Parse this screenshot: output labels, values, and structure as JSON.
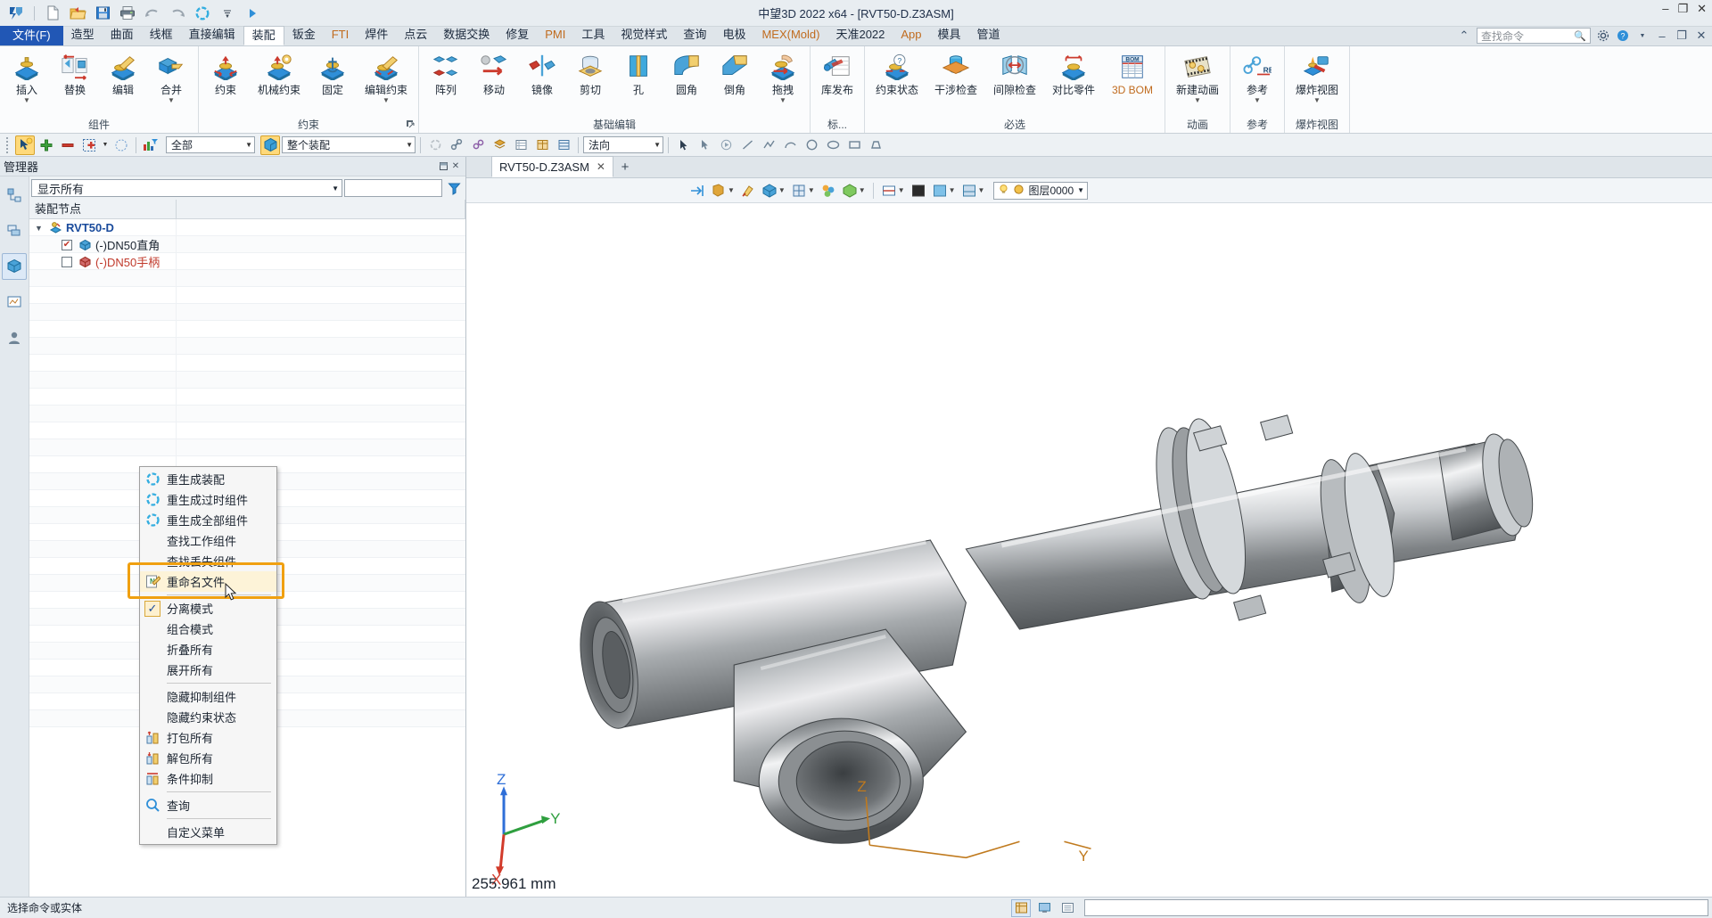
{
  "window": {
    "title": "中望3D 2022 x64 - [RVT50-D.Z3ASM]",
    "minimize": "–",
    "maximize": "❐",
    "close": "✕"
  },
  "quick_access": {
    "logo": "app-logo",
    "items": [
      {
        "name": "new-file-icon",
        "glyph": "new"
      },
      {
        "name": "open-file-icon",
        "glyph": "open"
      },
      {
        "name": "save-icon",
        "glyph": "save"
      },
      {
        "name": "print-icon",
        "glyph": "print"
      },
      {
        "name": "undo-icon",
        "glyph": "undo"
      },
      {
        "name": "redo-icon",
        "glyph": "redo"
      },
      {
        "name": "regen-icon",
        "glyph": "regen"
      },
      {
        "name": "qat-dropdown-icon",
        "glyph": "caret"
      },
      {
        "name": "play-icon",
        "glyph": "play"
      }
    ]
  },
  "tabs": [
    {
      "label": "文件(F)",
      "style": "file"
    },
    {
      "label": "造型",
      "style": "normal"
    },
    {
      "label": "曲面",
      "style": "normal"
    },
    {
      "label": "线框",
      "style": "normal"
    },
    {
      "label": "直接编辑",
      "style": "normal"
    },
    {
      "label": "装配",
      "style": "active"
    },
    {
      "label": "钣金",
      "style": "normal"
    },
    {
      "label": "FTI",
      "style": "orange"
    },
    {
      "label": "焊件",
      "style": "normal"
    },
    {
      "label": "点云",
      "style": "normal"
    },
    {
      "label": "数据交换",
      "style": "normal"
    },
    {
      "label": "修复",
      "style": "normal"
    },
    {
      "label": "PMI",
      "style": "orange"
    },
    {
      "label": "工具",
      "style": "normal"
    },
    {
      "label": "视觉样式",
      "style": "normal"
    },
    {
      "label": "查询",
      "style": "normal"
    },
    {
      "label": "电极",
      "style": "normal"
    },
    {
      "label": "MEX(Mold)",
      "style": "orange"
    },
    {
      "label": "天准2022",
      "style": "normal"
    },
    {
      "label": "App",
      "style": "orange"
    },
    {
      "label": "模具",
      "style": "normal"
    },
    {
      "label": "管道",
      "style": "normal"
    }
  ],
  "tabstrip_right": {
    "collapse_ribbon": "⌃",
    "search_placeholder": "查找命令",
    "search_value": "",
    "settings_icon": "gear-icon",
    "help_icon": "help-icon",
    "minimize": "–",
    "restore": "❐",
    "close": "✕"
  },
  "ribbon": {
    "groups": [
      {
        "label": "组件",
        "has_dialog_launcher": false,
        "buttons": [
          {
            "label": "插入",
            "icon": "insert-component-icon",
            "dropdown": true
          },
          {
            "label": "替换",
            "icon": "replace-component-icon",
            "dropdown": false
          },
          {
            "label": "编辑",
            "icon": "edit-component-icon",
            "dropdown": false
          },
          {
            "label": "合并",
            "icon": "merge-component-icon",
            "dropdown": true
          }
        ]
      },
      {
        "label": "约束",
        "has_dialog_launcher": true,
        "buttons": [
          {
            "label": "约束",
            "icon": "constraint-icon",
            "dropdown": false
          },
          {
            "label": "机械约束",
            "icon": "mechanical-constraint-icon",
            "dropdown": false
          },
          {
            "label": "固定",
            "icon": "fix-icon",
            "dropdown": false
          },
          {
            "label": "编辑约束",
            "icon": "edit-constraint-icon",
            "dropdown": true
          }
        ]
      },
      {
        "label": "基础编辑",
        "has_dialog_launcher": false,
        "buttons": [
          {
            "label": "阵列",
            "icon": "pattern-icon",
            "dropdown": false
          },
          {
            "label": "移动",
            "icon": "move-icon",
            "dropdown": false
          },
          {
            "label": "镜像",
            "icon": "mirror-icon",
            "dropdown": false
          },
          {
            "label": "剪切",
            "icon": "trim-icon",
            "dropdown": false
          },
          {
            "label": "孔",
            "icon": "hole-icon",
            "dropdown": false
          },
          {
            "label": "圆角",
            "icon": "fillet-icon",
            "dropdown": false
          },
          {
            "label": "倒角",
            "icon": "chamfer-icon",
            "dropdown": false
          },
          {
            "label": "拖拽",
            "icon": "drag-icon",
            "dropdown": true
          }
        ]
      },
      {
        "label": "标...",
        "has_dialog_launcher": false,
        "buttons": [
          {
            "label": "库发布",
            "icon": "library-publish-icon",
            "dropdown": false
          }
        ]
      },
      {
        "label": "必选",
        "has_dialog_launcher": false,
        "buttons": [
          {
            "label": "约束状态",
            "icon": "constraint-status-icon",
            "dropdown": false
          },
          {
            "label": "干涉检查",
            "icon": "interference-check-icon",
            "dropdown": false
          },
          {
            "label": "间隙检查",
            "icon": "clearance-check-icon",
            "dropdown": false
          },
          {
            "label": "对比零件",
            "icon": "compare-part-icon",
            "dropdown": false
          },
          {
            "label": "3D BOM",
            "icon": "bom-icon",
            "dropdown": false,
            "orange": true
          }
        ]
      },
      {
        "label": "动画",
        "has_dialog_launcher": false,
        "buttons": [
          {
            "label": "新建动画",
            "icon": "new-animation-icon",
            "dropdown": true
          }
        ]
      },
      {
        "label": "参考",
        "has_dialog_launcher": false,
        "buttons": [
          {
            "label": "参考",
            "icon": "reference-icon",
            "dropdown": true
          }
        ]
      },
      {
        "label": "爆炸视图",
        "has_dialog_launcher": false,
        "buttons": [
          {
            "label": "爆炸视图",
            "icon": "explode-view-icon",
            "dropdown": true
          }
        ]
      }
    ]
  },
  "toolbar2": {
    "icons_left": [
      {
        "name": "smart-select-icon",
        "selected": true
      },
      {
        "name": "add-component-icon",
        "selected": false
      },
      {
        "name": "remove-component-icon",
        "selected": false
      },
      {
        "name": "add-region-icon",
        "selected": false
      },
      {
        "name": "region-dropdown-icon",
        "selected": false
      },
      {
        "name": "circle-select-icon",
        "selected": false
      },
      {
        "name": "filter-icon",
        "selected": false
      }
    ],
    "filter_all": "全部",
    "scope_icon": "assembly-scope-icon",
    "scope_value": "整个装配",
    "icons_right": [
      {
        "name": "refresh-icon"
      },
      {
        "name": "link-icon"
      },
      {
        "name": "unlink-icon"
      },
      {
        "name": "layer-icon"
      },
      {
        "name": "list-icon"
      },
      {
        "name": "grid-icon"
      },
      {
        "name": "table-icon"
      }
    ],
    "direction_value": "法向",
    "draw_icons": [
      {
        "name": "pointer-icon"
      },
      {
        "name": "pick-icon"
      },
      {
        "name": "play-point-icon"
      },
      {
        "name": "line-icon"
      },
      {
        "name": "polyline-icon"
      },
      {
        "name": "arc-icon"
      },
      {
        "name": "circle-icon"
      },
      {
        "name": "ellipse-icon"
      },
      {
        "name": "rect-icon"
      },
      {
        "name": "shape-icon"
      }
    ]
  },
  "manager": {
    "title": "管理器",
    "pin_icon": "pin-icon",
    "close_icon": "close-icon",
    "rail": [
      {
        "name": "rail-history-icon",
        "active": false
      },
      {
        "name": "rail-layers-icon",
        "active": false
      },
      {
        "name": "rail-assembly-icon",
        "active": true
      },
      {
        "name": "rail-views-icon",
        "active": false
      },
      {
        "name": "rail-user-icon",
        "active": false
      }
    ],
    "filter_value": "显示所有",
    "search_value": "",
    "filter_button_icon": "funnel-icon",
    "tree_header": {
      "col1": "装配节点",
      "col2": ""
    },
    "tree": [
      {
        "level": 0,
        "expander": "▼",
        "checkbox": null,
        "icon": "assembly-root-icon",
        "label": "RVT50-D",
        "style": "root"
      },
      {
        "level": 1,
        "expander": "",
        "checkbox": "checked",
        "icon": "component-blue-icon",
        "label": "(-)DN50直角",
        "style": "normal"
      },
      {
        "level": 1,
        "expander": "",
        "checkbox": "unchecked",
        "icon": "component-red-icon",
        "label": "(-)DN50手柄",
        "style": "red"
      }
    ]
  },
  "context_menu": {
    "items": [
      {
        "label": "重生成装配",
        "icon": "regen-icon",
        "type": "item"
      },
      {
        "label": "重生成过时组件",
        "icon": "regen-icon",
        "type": "item"
      },
      {
        "label": "重生成全部组件",
        "icon": "regen-icon",
        "type": "item"
      },
      {
        "label": "查找工作组件",
        "icon": "",
        "type": "item"
      },
      {
        "label": "查找丢失组件",
        "icon": "",
        "type": "item"
      },
      {
        "label": "重命名文件",
        "icon": "rename-file-icon",
        "type": "item",
        "highlighted": true
      },
      {
        "label": "",
        "icon": "",
        "type": "separator"
      },
      {
        "label": "分离模式",
        "icon": "",
        "type": "check",
        "checked": true
      },
      {
        "label": "组合模式",
        "icon": "",
        "type": "item"
      },
      {
        "label": "折叠所有",
        "icon": "",
        "type": "item"
      },
      {
        "label": "展开所有",
        "icon": "",
        "type": "item"
      },
      {
        "label": "",
        "icon": "",
        "type": "separator"
      },
      {
        "label": "隐藏抑制组件",
        "icon": "",
        "type": "item"
      },
      {
        "label": "隐藏约束状态",
        "icon": "",
        "type": "item"
      },
      {
        "label": "打包所有",
        "icon": "pack-icon",
        "type": "item"
      },
      {
        "label": "解包所有",
        "icon": "unpack-icon",
        "type": "item"
      },
      {
        "label": "条件抑制",
        "icon": "suppress-icon",
        "type": "item"
      },
      {
        "label": "",
        "icon": "",
        "type": "separator"
      },
      {
        "label": "查询",
        "icon": "query-icon",
        "type": "item"
      },
      {
        "label": "",
        "icon": "",
        "type": "separator"
      },
      {
        "label": "自定义菜单",
        "icon": "",
        "type": "item"
      }
    ],
    "highlight_color": "#f0a010"
  },
  "document_tabs": {
    "tabs": [
      {
        "label": "RVT50-D.Z3ASM",
        "close": "✕"
      }
    ],
    "add_label": "+"
  },
  "view_toolbar": {
    "icons": [
      {
        "name": "fit-view-icon",
        "dropdown": false
      },
      {
        "name": "zoom-icon",
        "dropdown": true
      },
      {
        "name": "pan-icon",
        "dropdown": false
      },
      {
        "name": "shade-icon",
        "dropdown": true
      },
      {
        "name": "view-orient-icon",
        "dropdown": true
      },
      {
        "name": "render-style-icon",
        "dropdown": false
      },
      {
        "name": "visual-style-icon",
        "dropdown": true
      },
      {
        "name": "section-icon",
        "dropdown": true
      },
      {
        "name": "display-mode-icon",
        "dropdown": true
      },
      {
        "name": "background-black-icon",
        "dropdown": false
      },
      {
        "name": "background-color-icon",
        "dropdown": true
      }
    ],
    "layer_bulb_icon": "bulb-icon",
    "layer_swatch_icon": "layer-color-icon",
    "layer_value": "图层0000"
  },
  "viewport": {
    "dimension_text": "255.961 mm",
    "triad": {
      "x": "X",
      "y": "Y",
      "z": "Z"
    },
    "explode_axes": {
      "z": "Z",
      "y": "Y"
    },
    "model_name": "RVT50-D tee valve assembly"
  },
  "statusbar": {
    "message": "选择命令或实体",
    "icons": [
      {
        "name": "status-grid-icon",
        "active": true
      },
      {
        "name": "status-monitor-icon",
        "active": false
      },
      {
        "name": "status-list-icon",
        "active": false
      }
    ],
    "input_value": ""
  },
  "colors": {
    "accent_blue": "#2157b5",
    "highlight_orange": "#f0a010",
    "tree_red": "#c0392b",
    "tree_root_blue": "#1a4b9c",
    "ribbon_bg": "#fbfcfd",
    "panel_bg": "#eef2f5"
  }
}
